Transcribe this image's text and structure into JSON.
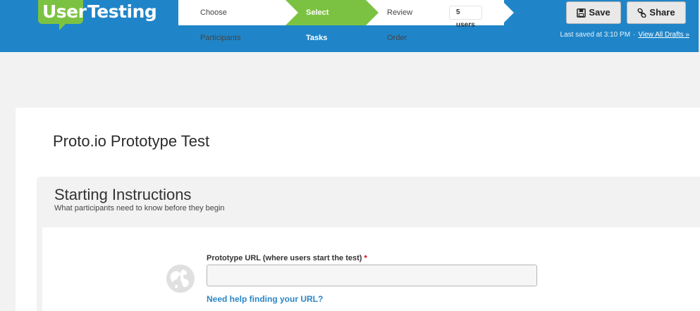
{
  "brand": {
    "logo_user": "User",
    "logo_testing": "Testing",
    "logo_mark": "®",
    "primary_color": "#1f85c8",
    "accent_color": "#7cc242"
  },
  "steps": [
    {
      "label": "Choose Participants",
      "active": false
    },
    {
      "label": "Select Tasks",
      "active": true
    },
    {
      "label": "Review Order",
      "active": false
    }
  ],
  "users_badge": "5 users",
  "toolbar": {
    "save_label": "Save",
    "save_icon": "floppy-disk-icon",
    "share_label": "Share",
    "share_icon": "link-icon"
  },
  "status": {
    "last_saved": "Last saved at 3:10 PM",
    "separator": "·",
    "view_drafts": "View All Drafts »"
  },
  "test": {
    "title": "Proto.io Prototype Test"
  },
  "section": {
    "title": "Starting Instructions",
    "subtitle": "What participants need to know before they begin"
  },
  "form": {
    "url_label": "Prototype URL (where users start the test)",
    "required_mark": "*",
    "url_value": "",
    "help_link": "Need help finding your URL?",
    "globe_icon": "globe-icon"
  }
}
